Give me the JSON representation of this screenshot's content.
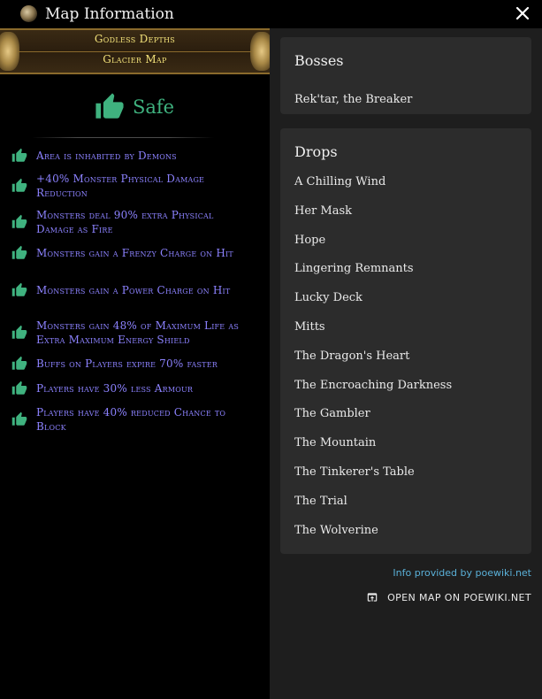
{
  "window": {
    "title": "Map Information",
    "icon": "map-orb-icon",
    "close_icon": "close-icon"
  },
  "map": {
    "name": "Godless Depths",
    "base": "Glacier Map",
    "status": "Safe",
    "status_icon": "thumbs-up-icon",
    "status_color": "#3fb27f"
  },
  "mods": [
    {
      "text": "Area is inhabited by Demons",
      "icon": "thumbs-up-icon"
    },
    {
      "text": "+40% Monster Physical Damage Reduction",
      "icon": "thumbs-up-icon"
    },
    {
      "text": "Monsters deal 90% extra Physical Damage as Fire",
      "icon": "thumbs-up-icon"
    },
    {
      "text": "Monsters gain a Frenzy Charge on Hit",
      "icon": "thumbs-up-icon"
    },
    {
      "text": "Monsters gain a Power Charge on Hit",
      "icon": "thumbs-up-icon"
    },
    {
      "text": "Monsters gain 48% of Maximum Life as Extra Maximum Energy Shield",
      "icon": "thumbs-up-icon"
    },
    {
      "text": "Buffs on Players expire 70% faster",
      "icon": "thumbs-up-icon"
    },
    {
      "text": "Players have 30% less Armour",
      "icon": "thumbs-up-icon"
    },
    {
      "text": "Players have 40% reduced Chance to Block",
      "icon": "thumbs-up-icon"
    }
  ],
  "mod_color": "#8c82ff",
  "bosses": {
    "title": "Bosses",
    "items": [
      "Rek'tar, the Breaker"
    ]
  },
  "drops": {
    "title": "Drops",
    "items": [
      "A Chilling Wind",
      "Her Mask",
      "Hope",
      "Lingering Remnants",
      "Lucky Deck",
      "Mitts",
      "The Dragon's Heart",
      "The Encroaching Darkness",
      "The Gambler",
      "The Mountain",
      "The Tinkerer's Table",
      "The Trial",
      "The Wolverine"
    ]
  },
  "footer": {
    "info": "Info provided by poewiki.net",
    "link_label": "OPEN MAP ON POEWIKI.NET",
    "link_icon": "open-external-icon"
  }
}
